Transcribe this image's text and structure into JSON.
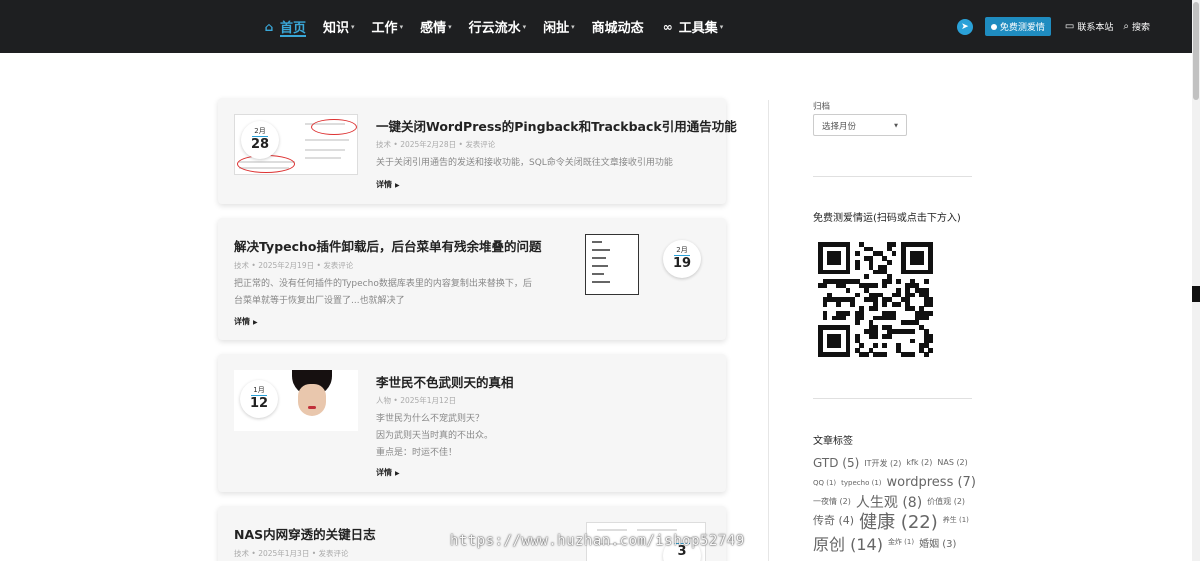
{
  "nav": {
    "items": [
      {
        "label": "首页",
        "icon": "home-icon",
        "active": true,
        "has_caret": false
      },
      {
        "label": "知识",
        "has_caret": true
      },
      {
        "label": "工作",
        "has_caret": true
      },
      {
        "label": "感情",
        "has_caret": true
      },
      {
        "label": "行云流水",
        "has_caret": true
      },
      {
        "label": "闲扯",
        "has_caret": true
      },
      {
        "label": "商城动态",
        "has_caret": false
      },
      {
        "label": "工具集",
        "icon": "link-icon",
        "has_caret": true
      }
    ],
    "right": {
      "free_button": "免费测爱情",
      "contact": "联系本站",
      "search": "搜索"
    }
  },
  "posts": [
    {
      "title": "一键关闭WordPress的Pingback和Trackback引用通告功能",
      "category": "技术",
      "date": "2025年2月28日",
      "comment": "发表评论",
      "excerpt": [
        "关于关闭引用通告的发送和接收功能，SQL命令关闭既往文章接收引用功能"
      ],
      "more": "详情",
      "badge_month": "2月",
      "badge_day": "28"
    },
    {
      "title": "解决Typecho插件卸载后，后台菜单有残余堆叠的问题",
      "category": "技术",
      "date": "2025年2月19日",
      "comment": "发表评论",
      "excerpt": [
        "把正常的、没有任何插件的Typecho数据库表里的内容复制出来替换下，后",
        "台菜单就等于恢复出厂设置了...也就解决了"
      ],
      "more": "详情",
      "badge_month": "2月",
      "badge_day": "19"
    },
    {
      "title": "李世民不色武则天的真相",
      "category": "人物",
      "date": "2025年1月12日",
      "comment": "",
      "excerpt": [
        "李世民为什么不宠武则天？",
        "因为武则天当时真的不出众。",
        "重点是：时运不佳！"
      ],
      "more": "详情",
      "badge_month": "1月",
      "badge_day": "12"
    },
    {
      "title": "NAS内网穿透的关键日志",
      "category": "技术",
      "date": "2025年1月3日",
      "comment": "发表评论",
      "excerpt": [],
      "more": "",
      "badge_month": "",
      "badge_day": "3"
    }
  ],
  "sidebar": {
    "archive_label": "归档",
    "archive_select": "选择月份",
    "promo_title": "免费测爱情运(扫码或点击下方入)",
    "tags_title": "文章标签",
    "tags": [
      {
        "name": "GTD",
        "count": "(5)",
        "size": 12
      },
      {
        "name": "IT开发",
        "count": "(2)",
        "size": 8
      },
      {
        "name": "kfk",
        "count": "(2)",
        "size": 8
      },
      {
        "name": "NAS",
        "count": "(2)",
        "size": 8
      },
      {
        "name": "QQ",
        "count": "(1)",
        "size": 7
      },
      {
        "name": "typecho",
        "count": "(1)",
        "size": 7
      },
      {
        "name": "wordpress",
        "count": "(7)",
        "size": 13
      },
      {
        "name": "一夜情",
        "count": "(2)",
        "size": 8
      },
      {
        "name": "人生观",
        "count": "(8)",
        "size": 14
      },
      {
        "name": "价值观",
        "count": "(2)",
        "size": 8
      },
      {
        "name": "传奇",
        "count": "(4)",
        "size": 11
      },
      {
        "name": "健康",
        "count": "(22)",
        "size": 18
      },
      {
        "name": "养生",
        "count": "(1)",
        "size": 7
      },
      {
        "name": "原创",
        "count": "(14)",
        "size": 16
      },
      {
        "name": "金炸",
        "count": "(1)",
        "size": 7
      },
      {
        "name": "婚姻",
        "count": "(3)",
        "size": 10
      }
    ]
  },
  "watermark": "https://www.huzhan.com/ishop52749",
  "colors": {
    "nav_bg": "#1e1f21",
    "accent": "#3aa7d8",
    "card_bg": "#f6f6f6"
  }
}
